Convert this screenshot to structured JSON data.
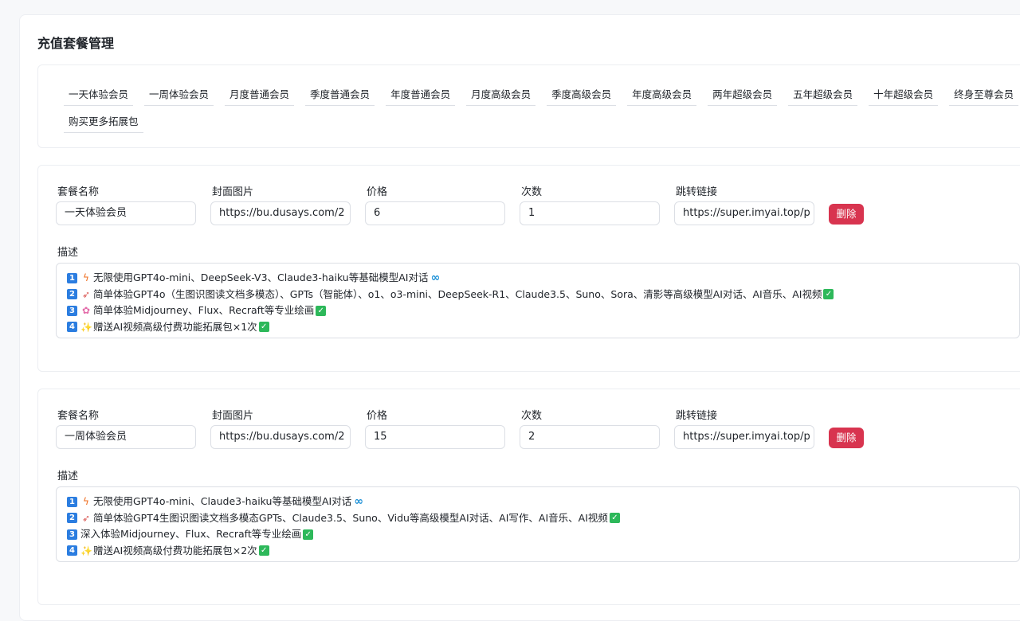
{
  "page_title": "充值套餐管理",
  "tags": [
    "一天体验会员",
    "一周体验会员",
    "月度普通会员",
    "季度普通会员",
    "年度普通会员",
    "月度高级会员",
    "季度高级会员",
    "年度高级会员",
    "两年超级会员",
    "五年超级会员",
    "十年超级会员",
    "终身至尊会员",
    "购买更多拓展包"
  ],
  "labels": {
    "name": "套餐名称",
    "cover": "封面图片",
    "price": "价格",
    "count": "次数",
    "link": "跳转链接",
    "delete": "删除",
    "desc": "描述"
  },
  "packages": [
    {
      "name": "一天体验会员",
      "cover": "https://bu.dusays.com/2",
      "price": "6",
      "count": "1",
      "link": "https://super.imyai.top/p",
      "desc": [
        {
          "num": "1",
          "icon": "lightning-icon",
          "text": "无限使用GPT4o-mini、DeepSeek-V3、Claude3-haiku等基础模型AI对话",
          "tail": "infinity-icon"
        },
        {
          "num": "2",
          "icon": "rocket-icon",
          "text": "简单体验GPT4o（生图识图读文档多模态）、GPTs（智能体）、o1、o3-mini、DeepSeek-R1、Claude3.5、Suno、Sora、清影等高级模型AI对话、AI音乐、AI视频",
          "tail": "check-icon"
        },
        {
          "num": "3",
          "icon": "flower-icon",
          "text": "简单体验Midjourney、Flux、Recraft等专业绘画",
          "tail": "check-icon"
        },
        {
          "num": "4",
          "icon": "sparkles-icon",
          "text": "赠送AI视频高级付费功能拓展包×1次",
          "tail": "check-icon"
        }
      ]
    },
    {
      "name": "一周体验会员",
      "cover": "https://bu.dusays.com/2",
      "price": "15",
      "count": "2",
      "link": "https://super.imyai.top/p",
      "desc": [
        {
          "num": "1",
          "icon": "lightning-icon",
          "text": "无限使用GPT4o-mini、Claude3-haiku等基础模型AI对话",
          "tail": "infinity-icon"
        },
        {
          "num": "2",
          "icon": "rocket-icon",
          "text": "简单体验GPT4生图识图读文档多模态GPTs、Claude3.5、Suno、Vidu等高级模型AI对话、AI写作、AI音乐、AI视频",
          "tail": "check-icon"
        },
        {
          "num": "3",
          "icon": "",
          "text": "深入体验Midjourney、Flux、Recraft等专业绘画",
          "tail": "check-icon"
        },
        {
          "num": "4",
          "icon": "sparkles-icon",
          "text": "赠送AI视频高级付费功能拓展包×2次",
          "tail": "check-icon"
        }
      ]
    }
  ]
}
